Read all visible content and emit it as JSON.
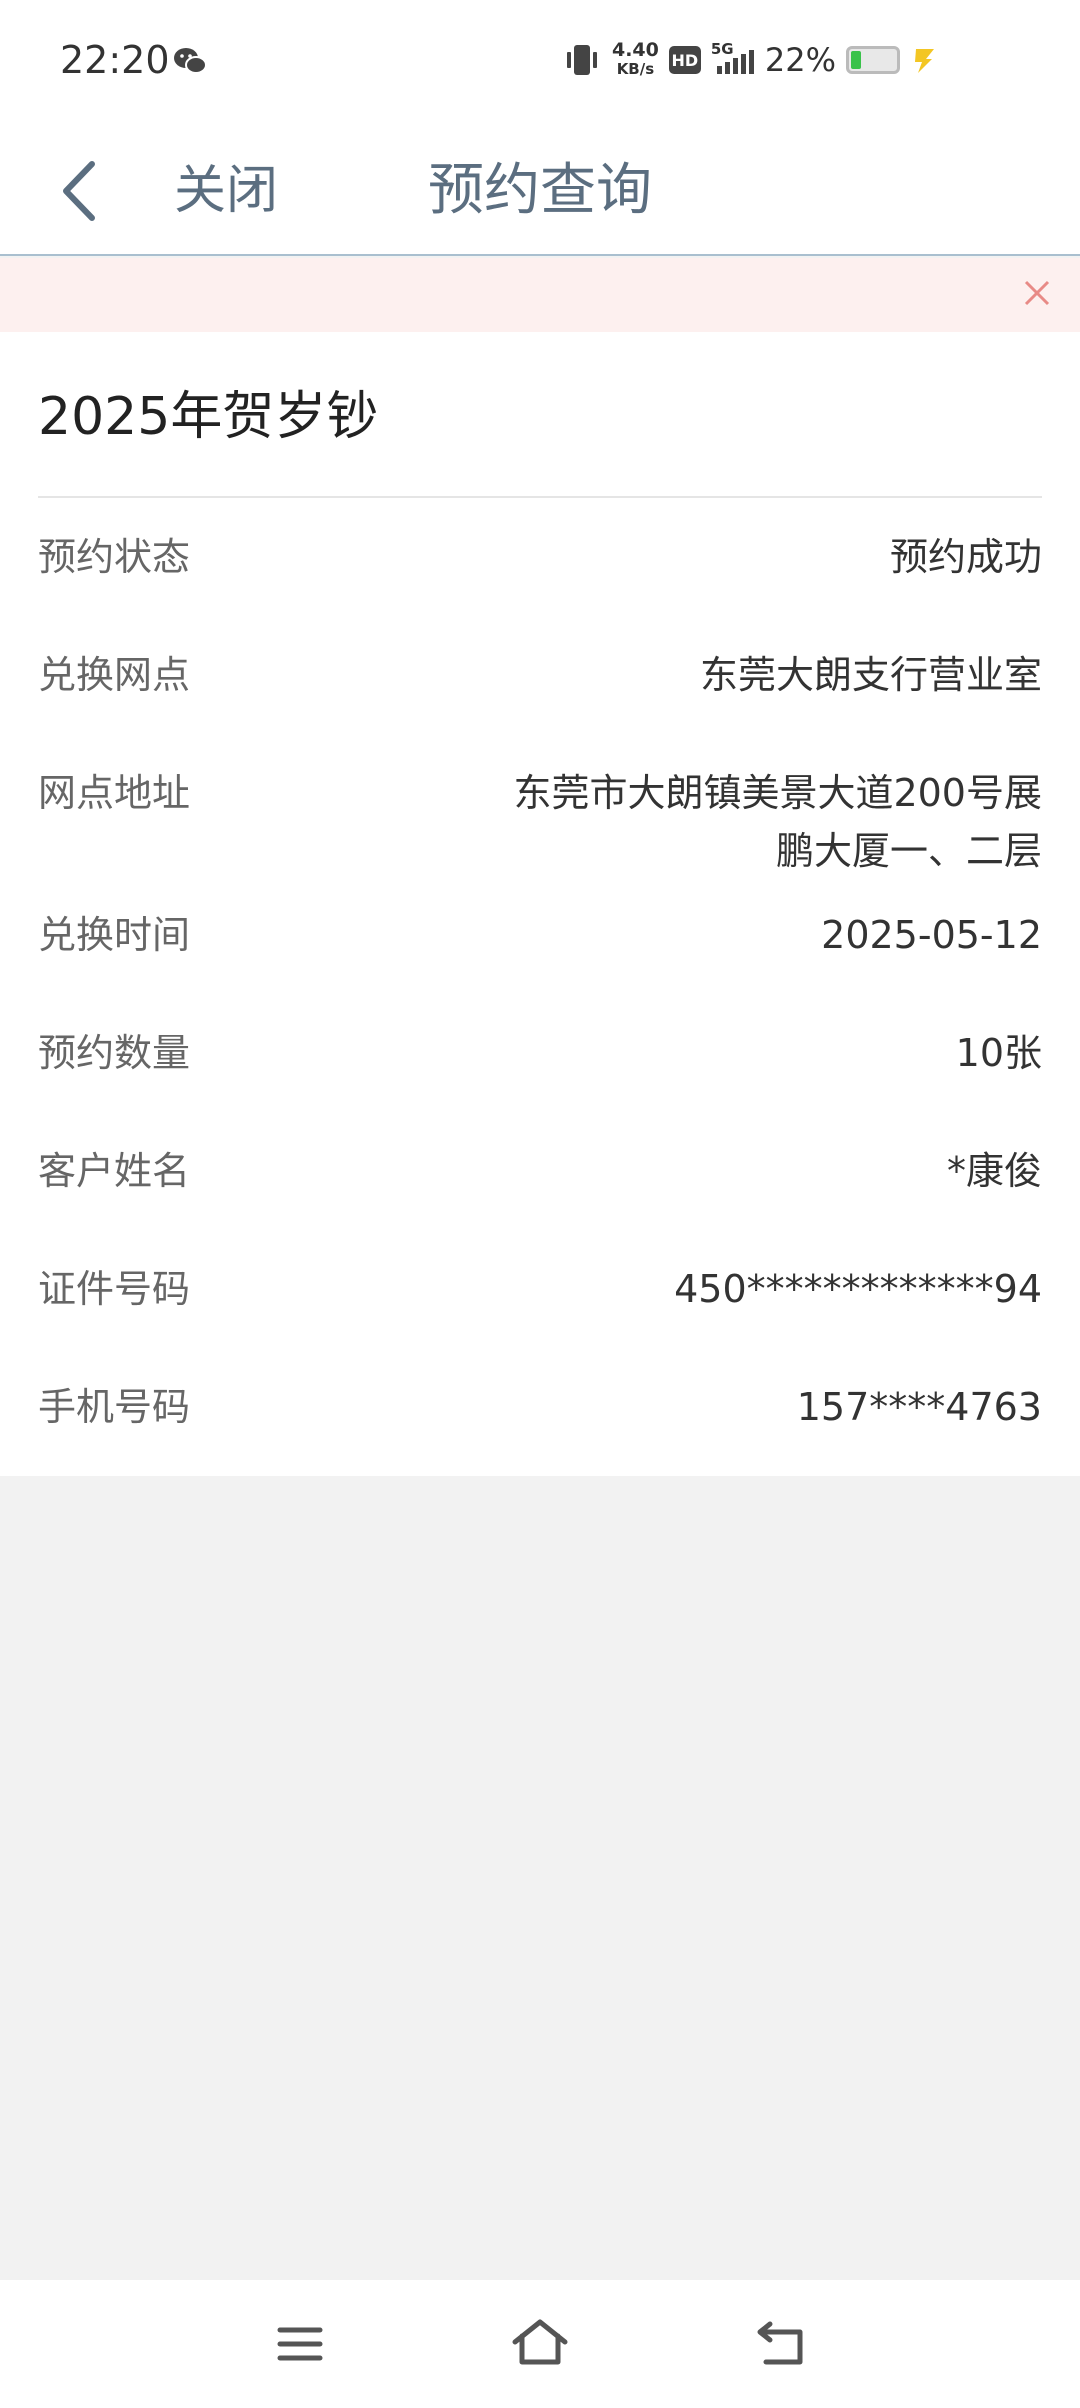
{
  "status_bar": {
    "time": "22:20",
    "net_speed_value": "4.40",
    "net_speed_unit": "KB/s",
    "hd_label": "HD",
    "network_label": "5G",
    "battery_percent": "22%",
    "battery_level": 0.22
  },
  "nav": {
    "close_label": "关闭",
    "title": "预约查询"
  },
  "card": {
    "title": "2025年贺岁钞",
    "rows": [
      {
        "label": "预约状态",
        "value": "预约成功"
      },
      {
        "label": "兑换网点",
        "value": "东莞大朗支行营业室"
      },
      {
        "label": "网点地址",
        "value_line1": "东莞市大朗镇美景大道200号展",
        "value_line2": "鹏大厦一、二层"
      },
      {
        "label": "兑换时间",
        "value": "2025-05-12"
      },
      {
        "label": "预约数量",
        "value": "10张"
      },
      {
        "label": "客户姓名",
        "value": "*康俊"
      },
      {
        "label": "证件号码",
        "value": "450*************94"
      },
      {
        "label": "手机号码",
        "value": "157****4763"
      }
    ]
  },
  "colors": {
    "nav_text": "#5b6e80",
    "notice_bg": "#fdf0ef",
    "notice_close": "#e88a86",
    "page_bg": "#f2f2f2"
  },
  "icons": {
    "back": "chevron-left-icon",
    "notice_close": "close-icon",
    "menu": "menu-icon",
    "home": "home-icon",
    "system_back": "back-icon"
  }
}
